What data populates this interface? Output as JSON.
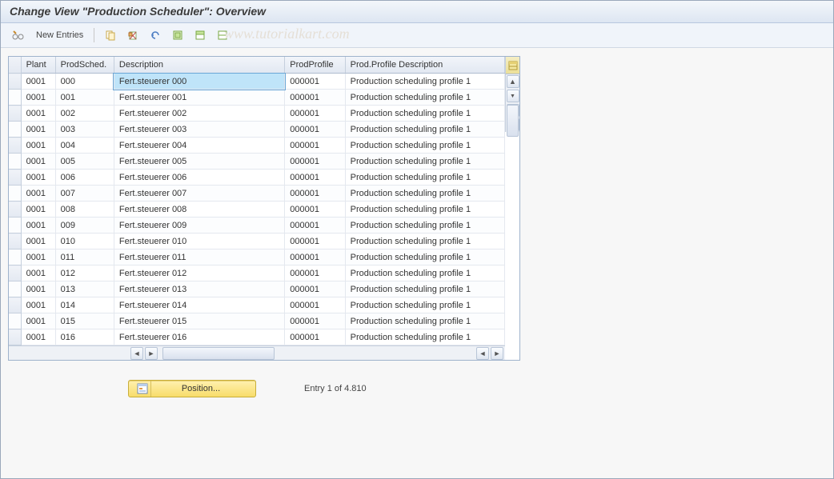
{
  "title": "Change View \"Production Scheduler\": Overview",
  "toolbar": {
    "new_entries_label": "New Entries"
  },
  "watermark": "www.tutorialkart.com",
  "columns": {
    "plant": "Plant",
    "sched": "ProdSched.",
    "desc": "Description",
    "profile": "ProdProfile",
    "pdesc": "Prod.Profile Description"
  },
  "rows": [
    {
      "plant": "0001",
      "sched": "000",
      "desc": "Fert.steuerer 000",
      "profile": "000001",
      "pdesc": "Production scheduling profile 1"
    },
    {
      "plant": "0001",
      "sched": "001",
      "desc": "Fert.steuerer 001",
      "profile": "000001",
      "pdesc": "Production scheduling profile 1"
    },
    {
      "plant": "0001",
      "sched": "002",
      "desc": "Fert.steuerer 002",
      "profile": "000001",
      "pdesc": "Production scheduling profile 1"
    },
    {
      "plant": "0001",
      "sched": "003",
      "desc": "Fert.steuerer 003",
      "profile": "000001",
      "pdesc": "Production scheduling profile 1"
    },
    {
      "plant": "0001",
      "sched": "004",
      "desc": "Fert.steuerer 004",
      "profile": "000001",
      "pdesc": "Production scheduling profile 1"
    },
    {
      "plant": "0001",
      "sched": "005",
      "desc": "Fert.steuerer 005",
      "profile": "000001",
      "pdesc": "Production scheduling profile 1"
    },
    {
      "plant": "0001",
      "sched": "006",
      "desc": "Fert.steuerer 006",
      "profile": "000001",
      "pdesc": "Production scheduling profile 1"
    },
    {
      "plant": "0001",
      "sched": "007",
      "desc": "Fert.steuerer 007",
      "profile": "000001",
      "pdesc": "Production scheduling profile 1"
    },
    {
      "plant": "0001",
      "sched": "008",
      "desc": "Fert.steuerer 008",
      "profile": "000001",
      "pdesc": "Production scheduling profile 1"
    },
    {
      "plant": "0001",
      "sched": "009",
      "desc": "Fert.steuerer 009",
      "profile": "000001",
      "pdesc": "Production scheduling profile 1"
    },
    {
      "plant": "0001",
      "sched": "010",
      "desc": "Fert.steuerer 010",
      "profile": "000001",
      "pdesc": "Production scheduling profile 1"
    },
    {
      "plant": "0001",
      "sched": "011",
      "desc": "Fert.steuerer 011",
      "profile": "000001",
      "pdesc": "Production scheduling profile 1"
    },
    {
      "plant": "0001",
      "sched": "012",
      "desc": "Fert.steuerer 012",
      "profile": "000001",
      "pdesc": "Production scheduling profile 1"
    },
    {
      "plant": "0001",
      "sched": "013",
      "desc": "Fert.steuerer 013",
      "profile": "000001",
      "pdesc": "Production scheduling profile 1"
    },
    {
      "plant": "0001",
      "sched": "014",
      "desc": "Fert.steuerer 014",
      "profile": "000001",
      "pdesc": "Production scheduling profile 1"
    },
    {
      "plant": "0001",
      "sched": "015",
      "desc": "Fert.steuerer 015",
      "profile": "000001",
      "pdesc": "Production scheduling profile 1"
    },
    {
      "plant": "0001",
      "sched": "016",
      "desc": "Fert.steuerer 016",
      "profile": "000001",
      "pdesc": "Production scheduling profile 1"
    }
  ],
  "selected_row_index": 0,
  "selected_col": "desc",
  "position_button_label": "Position...",
  "entry_status": "Entry 1 of 4.810"
}
